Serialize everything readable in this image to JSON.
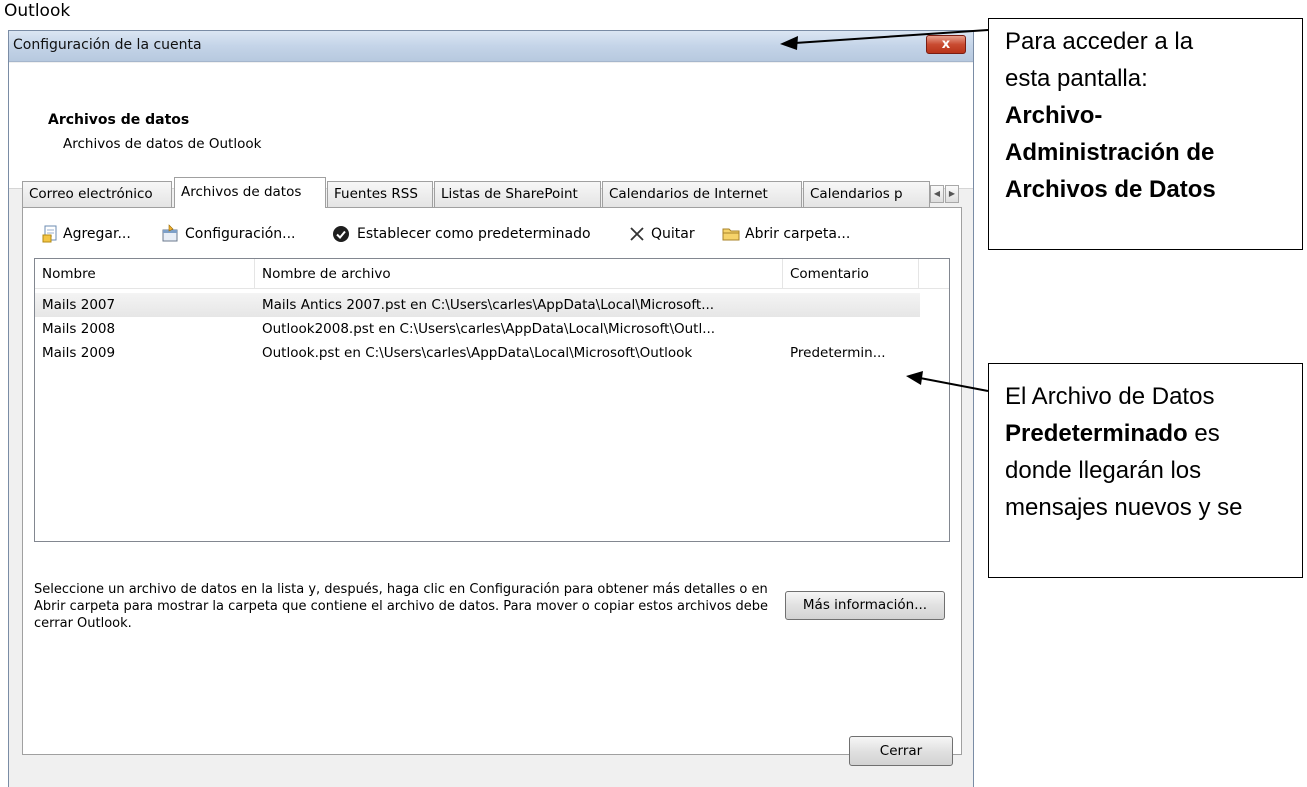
{
  "caption": "Outlook",
  "window": {
    "title": "Configuración de la cuenta",
    "close_glyph": "x"
  },
  "header": {
    "title": "Archivos de datos",
    "subtitle": "Archivos de datos de Outlook"
  },
  "tabs": [
    {
      "label": "Correo electrónico",
      "active": false
    },
    {
      "label": "Archivos de datos",
      "active": true
    },
    {
      "label": "Fuentes RSS",
      "active": false
    },
    {
      "label": "Listas de SharePoint",
      "active": false
    },
    {
      "label": "Calendarios de Internet",
      "active": false
    },
    {
      "label": "Calendarios p",
      "active": false
    }
  ],
  "toolbar": {
    "add": "Agregar...",
    "settings": "Configuración...",
    "set_default": "Establecer como predeterminado",
    "remove": "Quitar",
    "open_folder": "Abrir carpeta..."
  },
  "list": {
    "columns": [
      "Nombre",
      "Nombre de archivo",
      "Comentario"
    ],
    "rows": [
      {
        "name": "Mails 2007",
        "file": "Mails Antics 2007.pst en C:\\Users\\carles\\AppData\\Local\\Microsoft...",
        "comment": ""
      },
      {
        "name": "Mails 2008",
        "file": "Outlook2008.pst en C:\\Users\\carles\\AppData\\Local\\Microsoft\\Outl...",
        "comment": ""
      },
      {
        "name": "Mails 2009",
        "file": "Outlook.pst en C:\\Users\\carles\\AppData\\Local\\Microsoft\\Outlook",
        "comment": "Predetermin..."
      }
    ]
  },
  "info_text": "Seleccione un archivo de datos en la lista y, después, haga clic en Configuración para obtener más detalles o en Abrir carpeta para mostrar la carpeta que contiene el archivo de datos. Para mover o copiar estos archivos debe cerrar Outlook.",
  "more_info_button": "Más información...",
  "close_button": "Cerrar",
  "callout1": {
    "line1": "Para acceder a la",
    "line2": "esta pantalla:",
    "bold1": "Archivo-",
    "bold2": "Administración de",
    "bold3": "Archivos de Datos"
  },
  "callout2": {
    "line1": "El Archivo de Datos",
    "bold": "Predeterminado",
    "line2_rest": " es",
    "line3": "donde llegarán los",
    "line4": "mensajes nuevos y se"
  }
}
